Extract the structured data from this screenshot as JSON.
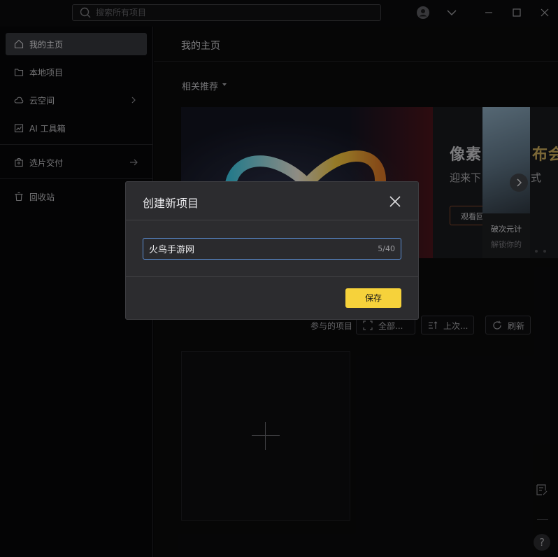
{
  "search": {
    "placeholder": "搜索所有项目"
  },
  "topbar": {
    "icons": [
      "user-icon",
      "chevron-down-icon",
      "minimize-icon",
      "maximize-icon",
      "close-icon"
    ]
  },
  "sidebar": {
    "items": [
      {
        "label": "我的主页",
        "icon": "home-icon",
        "active": true
      },
      {
        "label": "本地项目",
        "icon": "folder-icon"
      },
      {
        "label": "云空间",
        "icon": "cloud-icon",
        "arrow": "chevron-right-icon"
      },
      {
        "label": "AI 工具箱",
        "icon": "ai-toolbox-icon"
      },
      {
        "label": "选片交付",
        "icon": "bag-icon",
        "arrow": "arrow-right-icon"
      },
      {
        "label": "回收站",
        "icon": "trash-icon"
      }
    ]
  },
  "main": {
    "title": "我的主页",
    "section_title": "相关推荐",
    "banner": {
      "headline": "像素",
      "headline_tail": "布会",
      "subtitle": "迎来下",
      "subtitle_tail": "方式",
      "button": "观看回",
      "card_title": "破次元计",
      "card_subtitle": "解锁你的"
    },
    "filters": {
      "label": "参与的项目",
      "all": "全部...",
      "sort": "上次...",
      "refresh": "刷新"
    },
    "help": "?"
  },
  "dialog": {
    "title": "创建新项目",
    "input_value": "火鸟手游网",
    "counter": "5/40",
    "save": "保存"
  },
  "colors": {
    "accent": "#f6d23b",
    "focus_border": "#5b8fd6",
    "active_item": "#35363a"
  }
}
